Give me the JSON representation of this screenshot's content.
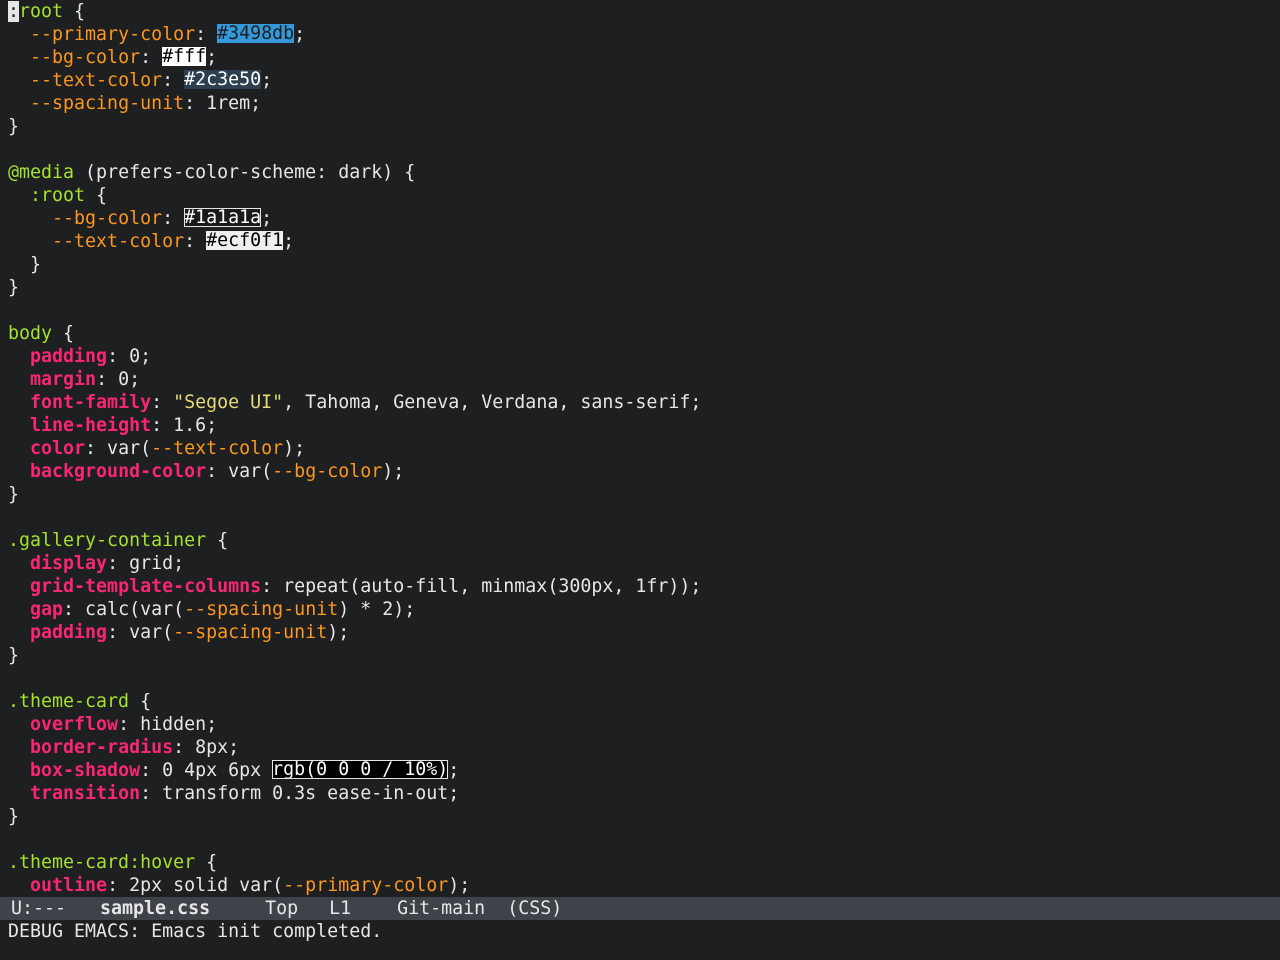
{
  "editor": {
    "file_name": "sample.css",
    "lines": [
      [
        {
          "t": ":",
          "c": "cursor"
        },
        {
          "t": "root",
          "c": "sel"
        },
        {
          "t": " {",
          "c": "txt"
        }
      ],
      [
        {
          "t": "  ",
          "c": "txt"
        },
        {
          "t": "--primary-color",
          "c": "var"
        },
        {
          "t": ": ",
          "c": "txt"
        },
        {
          "t": "#3498db",
          "c": "sw",
          "bg": "#3498db",
          "fg": "#1d1f21"
        },
        {
          "t": ";",
          "c": "txt"
        }
      ],
      [
        {
          "t": "  ",
          "c": "txt"
        },
        {
          "t": "--bg-color",
          "c": "var"
        },
        {
          "t": ": ",
          "c": "txt"
        },
        {
          "t": "#fff",
          "c": "sw",
          "bg": "#ffffff",
          "fg": "#000000"
        },
        {
          "t": ";",
          "c": "txt"
        }
      ],
      [
        {
          "t": "  ",
          "c": "txt"
        },
        {
          "t": "--text-color",
          "c": "var"
        },
        {
          "t": ": ",
          "c": "txt"
        },
        {
          "t": "#2c3e50",
          "c": "sw",
          "bg": "#2c3e50",
          "fg": "#ffffff"
        },
        {
          "t": ";",
          "c": "txt"
        }
      ],
      [
        {
          "t": "  ",
          "c": "txt"
        },
        {
          "t": "--spacing-unit",
          "c": "var"
        },
        {
          "t": ": 1rem;",
          "c": "txt"
        }
      ],
      [
        {
          "t": "}",
          "c": "txt"
        }
      ],
      [],
      [
        {
          "t": "@media",
          "c": "at"
        },
        {
          "t": " (prefers-color-scheme: dark) {",
          "c": "txt"
        }
      ],
      [
        {
          "t": "  ",
          "c": "txt"
        },
        {
          "t": ":root",
          "c": "sel"
        },
        {
          "t": " {",
          "c": "txt"
        }
      ],
      [
        {
          "t": "    ",
          "c": "txt"
        },
        {
          "t": "--bg-color",
          "c": "var"
        },
        {
          "t": ": ",
          "c": "txt"
        },
        {
          "t": "#1a1a1a",
          "c": "sw",
          "bg": "#1a1a1a",
          "fg": "#ffffff",
          "outline": true
        },
        {
          "t": ";",
          "c": "txt"
        }
      ],
      [
        {
          "t": "    ",
          "c": "txt"
        },
        {
          "t": "--text-color",
          "c": "var"
        },
        {
          "t": ": ",
          "c": "txt"
        },
        {
          "t": "#ecf0f1",
          "c": "sw",
          "bg": "#ecf0f1",
          "fg": "#000000"
        },
        {
          "t": ";",
          "c": "txt"
        }
      ],
      [
        {
          "t": "  }",
          "c": "txt"
        }
      ],
      [
        {
          "t": "}",
          "c": "txt"
        }
      ],
      [],
      [
        {
          "t": "body",
          "c": "sel"
        },
        {
          "t": " {",
          "c": "txt"
        }
      ],
      [
        {
          "t": "  ",
          "c": "txt"
        },
        {
          "t": "padding",
          "c": "prop"
        },
        {
          "t": ": 0;",
          "c": "txt"
        }
      ],
      [
        {
          "t": "  ",
          "c": "txt"
        },
        {
          "t": "margin",
          "c": "prop"
        },
        {
          "t": ": 0;",
          "c": "txt"
        }
      ],
      [
        {
          "t": "  ",
          "c": "txt"
        },
        {
          "t": "font-family",
          "c": "prop"
        },
        {
          "t": ": ",
          "c": "txt"
        },
        {
          "t": "\"Segoe UI\"",
          "c": "str"
        },
        {
          "t": ", Tahoma, Geneva, Verdana, sans-serif;",
          "c": "txt"
        }
      ],
      [
        {
          "t": "  ",
          "c": "txt"
        },
        {
          "t": "line-height",
          "c": "prop"
        },
        {
          "t": ": 1.6;",
          "c": "txt"
        }
      ],
      [
        {
          "t": "  ",
          "c": "txt"
        },
        {
          "t": "color",
          "c": "prop"
        },
        {
          "t": ": var(",
          "c": "txt"
        },
        {
          "t": "--text-color",
          "c": "var"
        },
        {
          "t": ");",
          "c": "txt"
        }
      ],
      [
        {
          "t": "  ",
          "c": "txt"
        },
        {
          "t": "background-color",
          "c": "prop"
        },
        {
          "t": ": var(",
          "c": "txt"
        },
        {
          "t": "--bg-color",
          "c": "var"
        },
        {
          "t": ");",
          "c": "txt"
        }
      ],
      [
        {
          "t": "}",
          "c": "txt"
        }
      ],
      [],
      [
        {
          "t": ".gallery-container",
          "c": "sel"
        },
        {
          "t": " {",
          "c": "txt"
        }
      ],
      [
        {
          "t": "  ",
          "c": "txt"
        },
        {
          "t": "display",
          "c": "prop"
        },
        {
          "t": ": grid;",
          "c": "txt"
        }
      ],
      [
        {
          "t": "  ",
          "c": "txt"
        },
        {
          "t": "grid-template-columns",
          "c": "prop"
        },
        {
          "t": ": repeat(auto-fill, minmax(300px, 1fr));",
          "c": "txt"
        }
      ],
      [
        {
          "t": "  ",
          "c": "txt"
        },
        {
          "t": "gap",
          "c": "prop"
        },
        {
          "t": ": calc(var(",
          "c": "txt"
        },
        {
          "t": "--spacing-unit",
          "c": "var"
        },
        {
          "t": ") * 2);",
          "c": "txt"
        }
      ],
      [
        {
          "t": "  ",
          "c": "txt"
        },
        {
          "t": "padding",
          "c": "prop"
        },
        {
          "t": ": var(",
          "c": "txt"
        },
        {
          "t": "--spacing-unit",
          "c": "var"
        },
        {
          "t": ");",
          "c": "txt"
        }
      ],
      [
        {
          "t": "}",
          "c": "txt"
        }
      ],
      [],
      [
        {
          "t": ".theme-card",
          "c": "sel"
        },
        {
          "t": " {",
          "c": "txt"
        }
      ],
      [
        {
          "t": "  ",
          "c": "txt"
        },
        {
          "t": "overflow",
          "c": "prop"
        },
        {
          "t": ": hidden;",
          "c": "txt"
        }
      ],
      [
        {
          "t": "  ",
          "c": "txt"
        },
        {
          "t": "border-radius",
          "c": "prop"
        },
        {
          "t": ": 8px;",
          "c": "txt"
        }
      ],
      [
        {
          "t": "  ",
          "c": "txt"
        },
        {
          "t": "box-shadow",
          "c": "prop"
        },
        {
          "t": ": 0 4px 6px ",
          "c": "txt"
        },
        {
          "t": "rgb(0 0 0 / 10%)",
          "c": "sw",
          "bg": "#000000",
          "fg": "#ffffff",
          "outline": true
        },
        {
          "t": ";",
          "c": "txt"
        }
      ],
      [
        {
          "t": "  ",
          "c": "txt"
        },
        {
          "t": "transition",
          "c": "prop"
        },
        {
          "t": ": transform 0.3s ease-in-out;",
          "c": "txt"
        }
      ],
      [
        {
          "t": "}",
          "c": "txt"
        }
      ],
      [],
      [
        {
          "t": ".theme-card:hover",
          "c": "sel"
        },
        {
          "t": " {",
          "c": "txt"
        }
      ],
      [
        {
          "t": "  ",
          "c": "txt"
        },
        {
          "t": "outline",
          "c": "prop"
        },
        {
          "t": ": 2px solid var(",
          "c": "txt"
        },
        {
          "t": "--primary-color",
          "c": "var"
        },
        {
          "t": ");",
          "c": "txt"
        }
      ]
    ]
  },
  "modeline": {
    "status": "U:---",
    "file": "sample.css",
    "position": "Top",
    "line": "L1",
    "vc": "Git-main",
    "mode": "(CSS)"
  },
  "echo_area": {
    "message": "DEBUG EMACS: Emacs init completed."
  },
  "colors": {
    "background": "#1d1f21",
    "modeline_bg": "#3e4349",
    "selector": "#a6e22e",
    "property": "#f92672",
    "variable": "#fd971f",
    "string": "#e6db74",
    "text": "#e6e6e6"
  }
}
